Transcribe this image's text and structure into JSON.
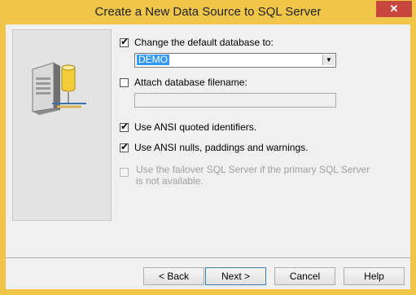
{
  "window": {
    "title": "Create a New Data Source to SQL Server",
    "close_glyph": "✕"
  },
  "options": {
    "change_db": {
      "label": "Change the default database to:",
      "checked": true
    },
    "database_value": "DEMO",
    "attach_db": {
      "label": "Attach database filename:",
      "checked": false
    },
    "attach_db_value": "",
    "ansi_quoted": {
      "label": "Use ANSI quoted identifiers.",
      "checked": true
    },
    "ansi_nulls": {
      "label": "Use ANSI nulls, paddings and warnings.",
      "checked": true
    },
    "failover": {
      "label": "Use the failover SQL Server if the primary SQL Server is not available.",
      "checked": false,
      "disabled": true
    }
  },
  "buttons": {
    "back": "< Back",
    "next": "Next >",
    "cancel": "Cancel",
    "help": "Help"
  },
  "icons": {
    "illustration": "database-server-icon",
    "dropdown": "chevron-down-icon"
  },
  "colors": {
    "title_bar": "#f0c64a",
    "close_button": "#c7463e",
    "selection": "#3399ff"
  }
}
